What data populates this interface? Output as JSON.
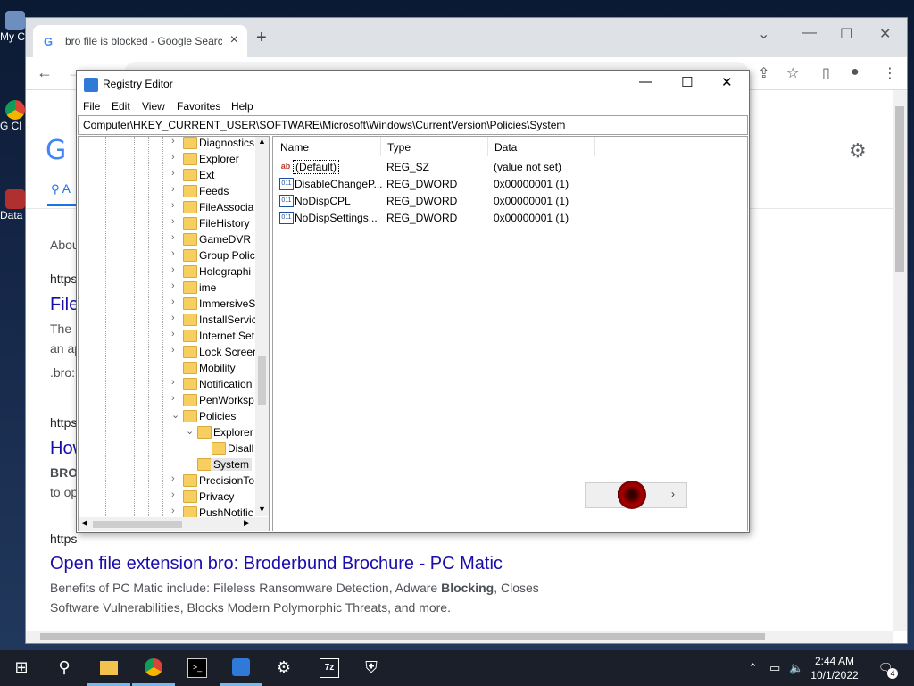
{
  "desktop": {
    "icons": [
      {
        "label": "My C",
        "icon": "computer-icon"
      },
      {
        "label": "G Cl",
        "icon": "chrome-shortcut-icon"
      },
      {
        "label": "Data",
        "icon": "data-shortcut-icon"
      }
    ]
  },
  "chrome": {
    "tab_title": "bro file is blocked - Google Search",
    "new_tab": "+",
    "page": {
      "logo": "G",
      "tab_label": "A",
      "about": "About",
      "results": [
        {
          "cite": "https",
          "title": "File",
          "lines": [
            "The",
            "an ap",
            ".bro:"
          ]
        },
        {
          "cite": "https",
          "title": "How",
          "lines": [
            "BRO",
            "to op"
          ]
        },
        {
          "cite": "https",
          "title": "Open file extension bro: Broderbund Brochure - PC Matic",
          "snippet_pre": "Benefits of PC Matic include: Fileless Ransomware Detection, Adware ",
          "snippet_bold": "Blocking",
          "snippet_post": ", Closes Software Vulnerabilities, Blocks Modern Polymorphic Threats, and more."
        }
      ]
    }
  },
  "regedit": {
    "title": "Registry Editor",
    "menu": [
      "File",
      "Edit",
      "View",
      "Favorites",
      "Help"
    ],
    "address": "Computer\\HKEY_CURRENT_USER\\SOFTWARE\\Microsoft\\Windows\\CurrentVersion\\Policies\\System",
    "tree": [
      {
        "label": "Diagnostics",
        "exp": "›",
        "level": 0
      },
      {
        "label": "Explorer",
        "exp": "›",
        "level": 0
      },
      {
        "label": "Ext",
        "exp": "›",
        "level": 0
      },
      {
        "label": "Feeds",
        "exp": "›",
        "level": 0
      },
      {
        "label": "FileAssocia",
        "exp": "›",
        "level": 0
      },
      {
        "label": "FileHistory",
        "exp": "›",
        "level": 0
      },
      {
        "label": "GameDVR",
        "exp": "›",
        "level": 0
      },
      {
        "label": "Group Polic",
        "exp": "›",
        "level": 0
      },
      {
        "label": "Holographi",
        "exp": "›",
        "level": 0
      },
      {
        "label": "ime",
        "exp": "›",
        "level": 0
      },
      {
        "label": "ImmersiveS",
        "exp": "›",
        "level": 0
      },
      {
        "label": "InstallServic",
        "exp": "›",
        "level": 0
      },
      {
        "label": "Internet Set",
        "exp": "›",
        "level": 0
      },
      {
        "label": "Lock Screer",
        "exp": "›",
        "level": 0
      },
      {
        "label": "Mobility",
        "exp": "",
        "level": 0
      },
      {
        "label": "Notification",
        "exp": "›",
        "level": 0
      },
      {
        "label": "PenWorksp",
        "exp": "›",
        "level": 0
      },
      {
        "label": "Policies",
        "exp": "⌄",
        "level": 0
      },
      {
        "label": "Explorer",
        "exp": "⌄",
        "level": 1
      },
      {
        "label": "Disall",
        "exp": "",
        "level": 2
      },
      {
        "label": "System",
        "exp": "",
        "level": 1,
        "selected": true
      },
      {
        "label": "PrecisionTo",
        "exp": "›",
        "level": 0
      },
      {
        "label": "Privacy",
        "exp": "›",
        "level": 0
      },
      {
        "label": "PushNotific",
        "exp": "›",
        "level": 0
      }
    ],
    "columns": [
      "Name",
      "Type",
      "Data"
    ],
    "values": [
      {
        "name": "(Default)",
        "type": "REG_SZ",
        "data": "(value not set)",
        "icon": "ab",
        "selected": true
      },
      {
        "name": "DisableChangeP...",
        "type": "REG_DWORD",
        "data": "0x00000001 (1)",
        "icon": "011"
      },
      {
        "name": "NoDispCPL",
        "type": "REG_DWORD",
        "data": "0x00000001 (1)",
        "icon": "011"
      },
      {
        "name": "NoDispSettings...",
        "type": "REG_DWORD",
        "data": "0x00000001 (1)",
        "icon": "011"
      }
    ],
    "popup": {
      "label": "N",
      "chevron": "›"
    }
  },
  "taskbar": {
    "time": "2:44 AM",
    "date": "10/1/2022",
    "notifications": "4"
  }
}
